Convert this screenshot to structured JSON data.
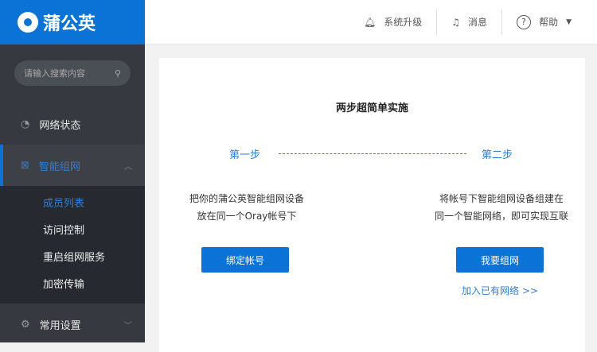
{
  "brand": "蒲公英",
  "header": {
    "upgrade": "系统升级",
    "messages": "消息",
    "help": "帮助"
  },
  "sidebar": {
    "search_placeholder": "请输入搜索内容",
    "items": [
      {
        "label": "网络状态"
      },
      {
        "label": "智能组网"
      },
      {
        "label": "常用设置"
      }
    ],
    "sub_items": [
      "成员列表",
      "访问控制",
      "重启组网服务",
      "加密传输"
    ]
  },
  "main": {
    "title": "两步超简单实施",
    "step1": "第一步",
    "step2": "第二步",
    "desc1_line1": "把你的蒲公英智能组网设备",
    "desc1_line2": "放在同一个Oray帐号下",
    "desc2_line1": "将帐号下智能组网设备组建在",
    "desc2_line2": "同一个智能网络，即可实现互联",
    "bind_button": "绑定帐号",
    "network_button": "我要组网",
    "join_link": "加入已有网络 >>"
  }
}
